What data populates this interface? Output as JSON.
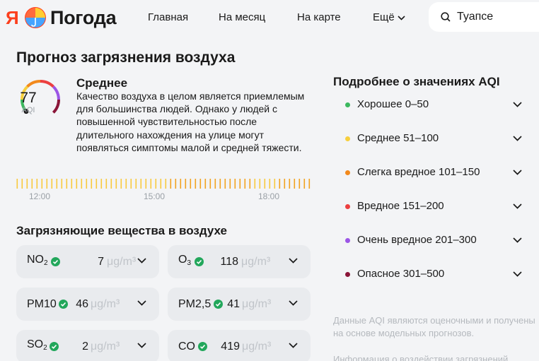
{
  "header": {
    "logo_letter": "Я",
    "logo_text": "Погода",
    "nav": [
      "Главная",
      "На месяц",
      "На карте",
      "Ещё"
    ],
    "search_value": "Туапсе"
  },
  "main": {
    "title": "Прогноз загрязнения воздуха",
    "aqi": {
      "value": "77",
      "unit": "AQI",
      "level": "Среднее",
      "description": "Качество воздуха в целом является приемлемым для большинства людей. Однако у людей с повышенной чувствительностью после длительного нахождения на улице могут появляться симптомы малой и средней тяжести.",
      "gauge_fraction": 0.26
    },
    "timeline": {
      "labels": [
        "12:00",
        "15:00",
        "18:00"
      ]
    },
    "pollutants_title": "Загрязняющие вещества в воздухе",
    "pollutants": [
      {
        "name": "NO",
        "sub": "2",
        "value": "7",
        "unit": "μg/m³"
      },
      {
        "name": "O",
        "sub": "3",
        "value": "118",
        "unit": "μg/m³"
      },
      {
        "name": "PM10",
        "sub": "",
        "value": "46",
        "unit": "μg/m³"
      },
      {
        "name": "PM2,5",
        "sub": "",
        "value": "41",
        "unit": "μg/m³"
      },
      {
        "name": "SO",
        "sub": "2",
        "value": "2",
        "unit": "μg/m³"
      },
      {
        "name": "CO",
        "sub": "",
        "value": "419",
        "unit": "μg/m³"
      }
    ]
  },
  "aqi_info": {
    "title": "Подробнее о значениях AQI",
    "levels": [
      {
        "label": "Хорошее 0–50",
        "color": "#3bb85e"
      },
      {
        "label": "Среднее 51–100",
        "color": "#f7cf3d"
      },
      {
        "label": "Слегка вредное 101–150",
        "color": "#f2891c"
      },
      {
        "label": "Вредное 151–200",
        "color": "#ec3f3f"
      },
      {
        "label": "Очень вредное 201–300",
        "color": "#9b55e6"
      },
      {
        "label": "Опасное 301–500",
        "color": "#8a1538"
      }
    ],
    "note": "Данные AQI являются оценочными и получены на основе модельных прогнозов.",
    "note2": "Информация о воздействии загрязнений"
  },
  "colors": {
    "check": "#22a75b",
    "bar_light": "#f8c93c",
    "bar_dark": "#f2a21e"
  }
}
